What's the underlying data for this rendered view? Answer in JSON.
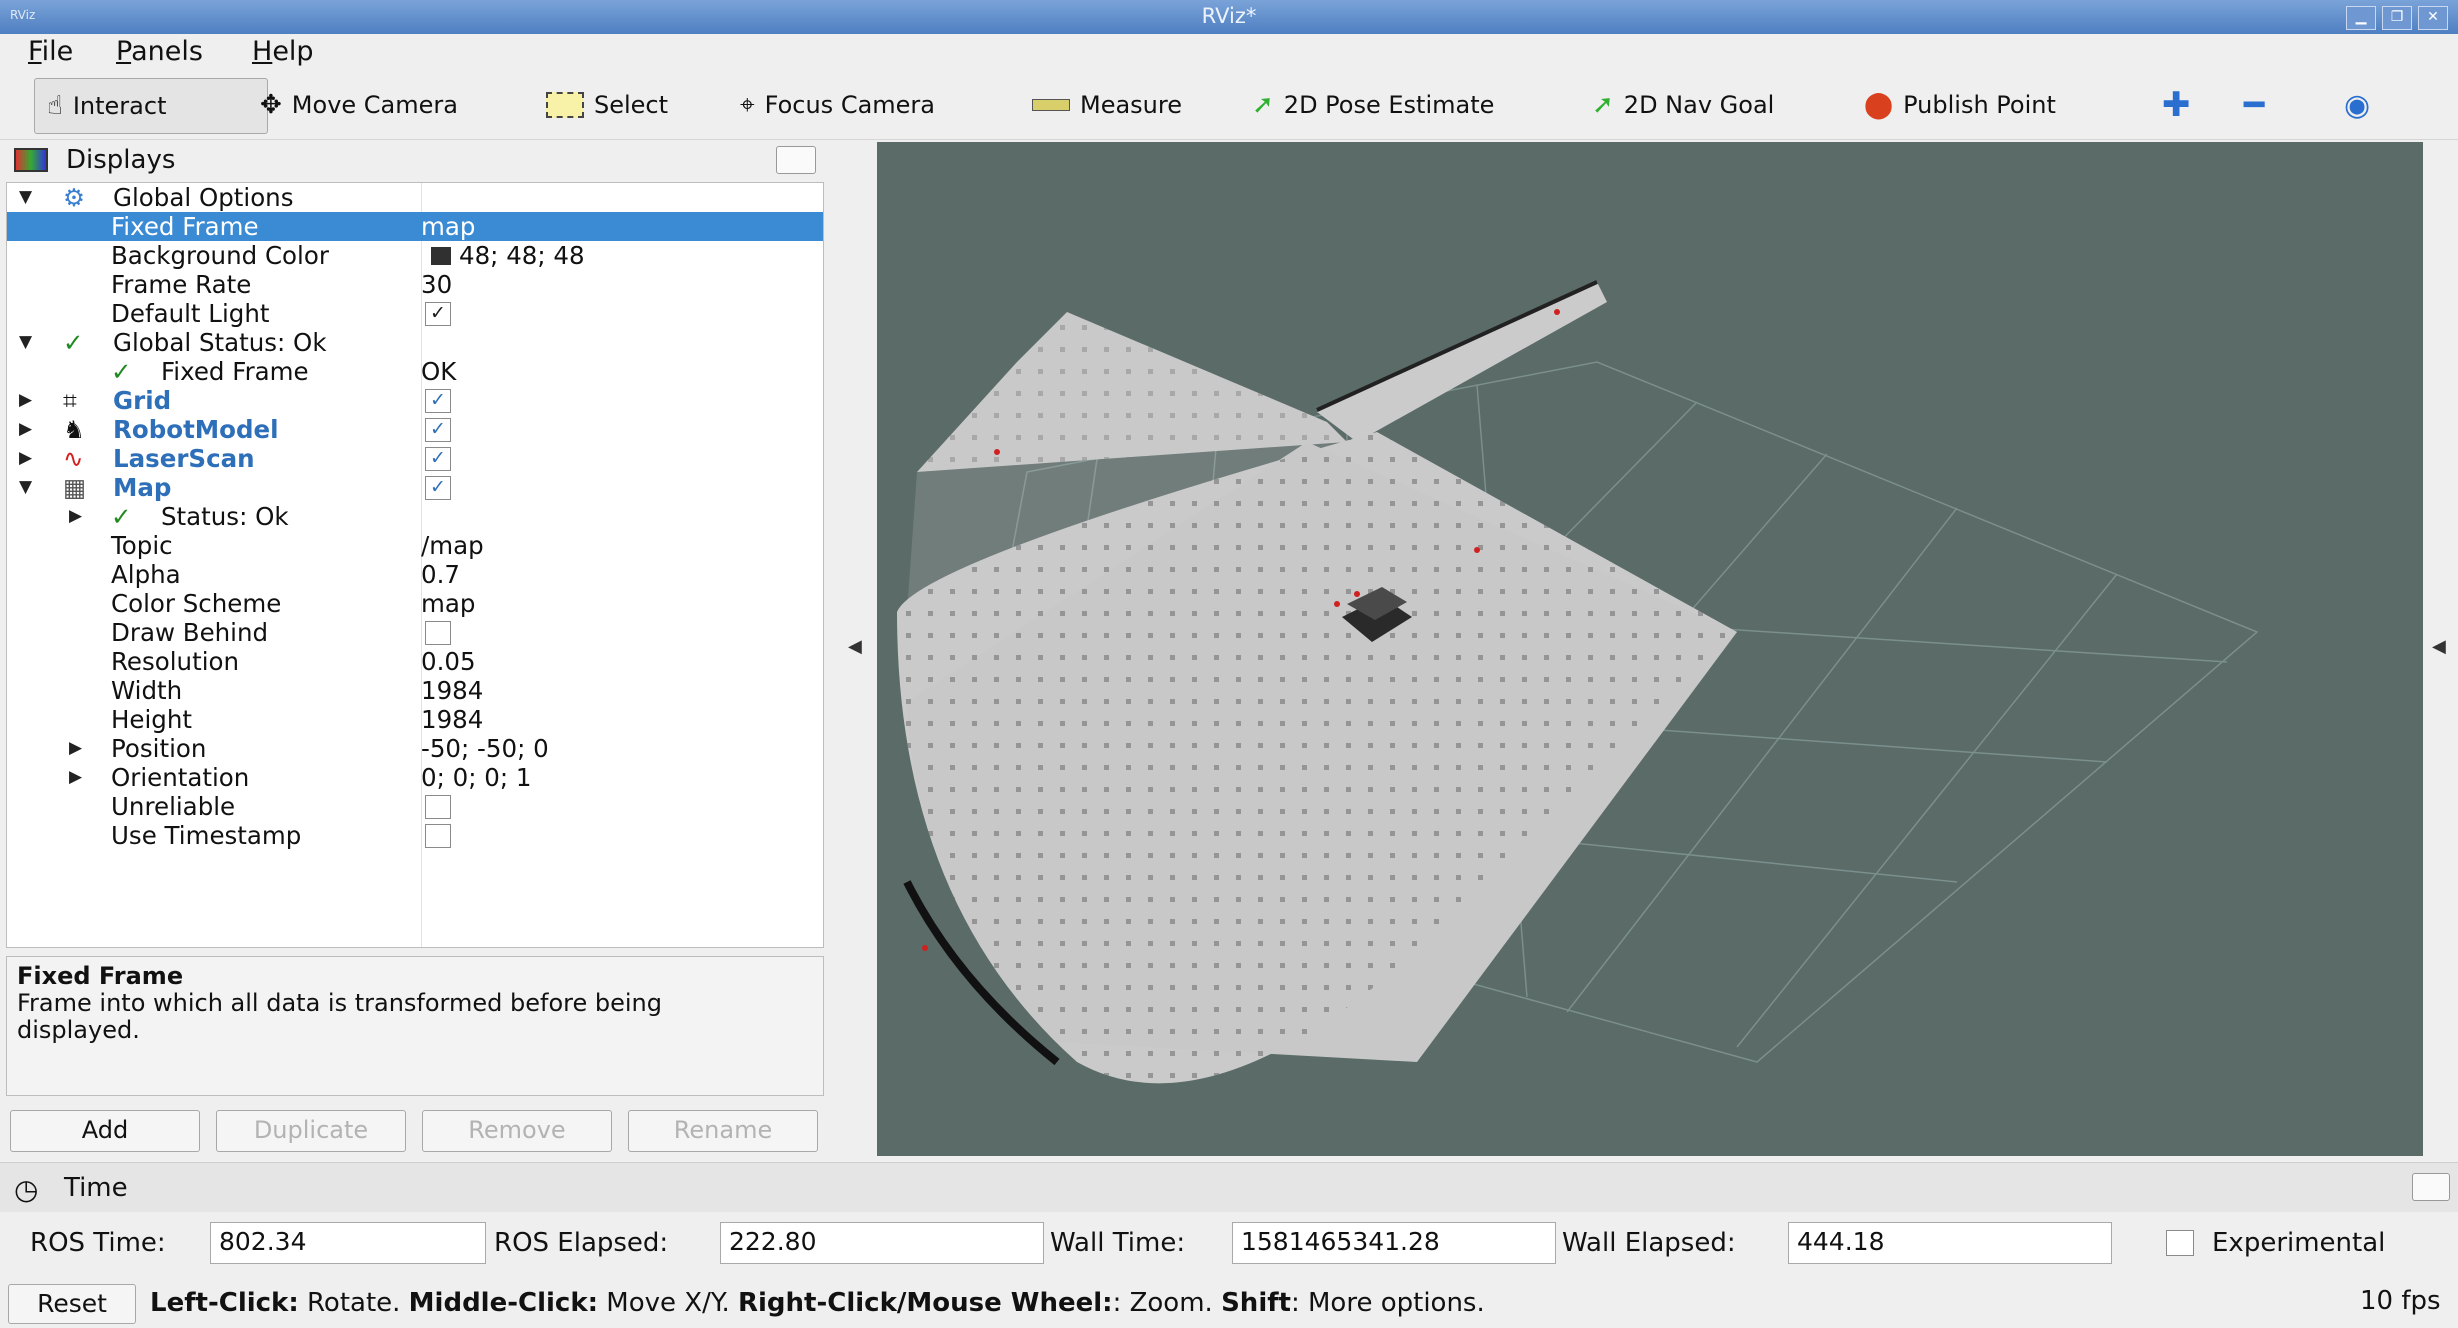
{
  "window": {
    "title": "RViz*",
    "app_icon": "RViz"
  },
  "menu": [
    {
      "label": "File",
      "key": "F",
      "rest": "ile"
    },
    {
      "label": "Panels",
      "key": "P",
      "rest": "anels"
    },
    {
      "label": "Help",
      "key": "H",
      "rest": "elp"
    }
  ],
  "toolbar": {
    "interact": "Interact",
    "move_camera": "Move Camera",
    "select": "Select",
    "focus_camera": "Focus Camera",
    "measure": "Measure",
    "pose_estimate": "2D Pose Estimate",
    "nav_goal": "2D Nav Goal",
    "publish_point": "Publish Point"
  },
  "displays": {
    "title": "Displays",
    "rows": {
      "global_options": "Global Options",
      "fixed_frame": "Fixed Frame",
      "fixed_frame_val": "map",
      "background_color": "Background Color",
      "background_color_val": "48; 48; 48",
      "frame_rate": "Frame Rate",
      "frame_rate_val": "30",
      "default_light": "Default Light",
      "global_status": "Global Status: Ok",
      "gs_fixed_frame": "Fixed Frame",
      "gs_fixed_frame_val": "OK",
      "grid": "Grid",
      "robot_model": "RobotModel",
      "laser_scan": "LaserScan",
      "map": "Map",
      "status": "Status: Ok",
      "topic": "Topic",
      "topic_val": "/map",
      "alpha": "Alpha",
      "alpha_val": "0.7",
      "color_scheme": "Color Scheme",
      "color_scheme_val": "map",
      "draw_behind": "Draw Behind",
      "resolution": "Resolution",
      "resolution_val": "0.05",
      "width": "Width",
      "width_val": "1984",
      "height": "Height",
      "height_val": "1984",
      "position": "Position",
      "position_val": "-50; -50; 0",
      "orientation": "Orientation",
      "orientation_val": "0; 0; 0; 1",
      "unreliable": "Unreliable",
      "use_timestamp": "Use Timestamp"
    },
    "description_title": "Fixed Frame",
    "description_text": "Frame into which all data is transformed before being displayed.",
    "buttons": {
      "add": "Add",
      "duplicate": "Duplicate",
      "remove": "Remove",
      "rename": "Rename"
    }
  },
  "time": {
    "title": "Time",
    "ros_time_label": "ROS Time:",
    "ros_time": "802.34",
    "ros_elapsed_label": "ROS Elapsed:",
    "ros_elapsed": "222.80",
    "wall_time_label": "Wall Time:",
    "wall_time": "1581465341.28",
    "wall_elapsed_label": "Wall Elapsed:",
    "wall_elapsed": "444.18",
    "experimental": "Experimental"
  },
  "status": {
    "reset": "Reset",
    "left_click": "Left-Click:",
    "left_click_txt": "Rotate.",
    "middle_click": "Middle-Click:",
    "middle_click_txt": "Move X/Y.",
    "right_click": "Right-Click/Mouse Wheel:",
    "right_click_txt": ": Zoom.",
    "shift": "Shift",
    "shift_txt": ": More options.",
    "fps": "10 fps"
  },
  "colors": {
    "view_bg": "#5a6b68",
    "selection": "#3a8ad4",
    "map_floor": "#c8c8c8"
  }
}
